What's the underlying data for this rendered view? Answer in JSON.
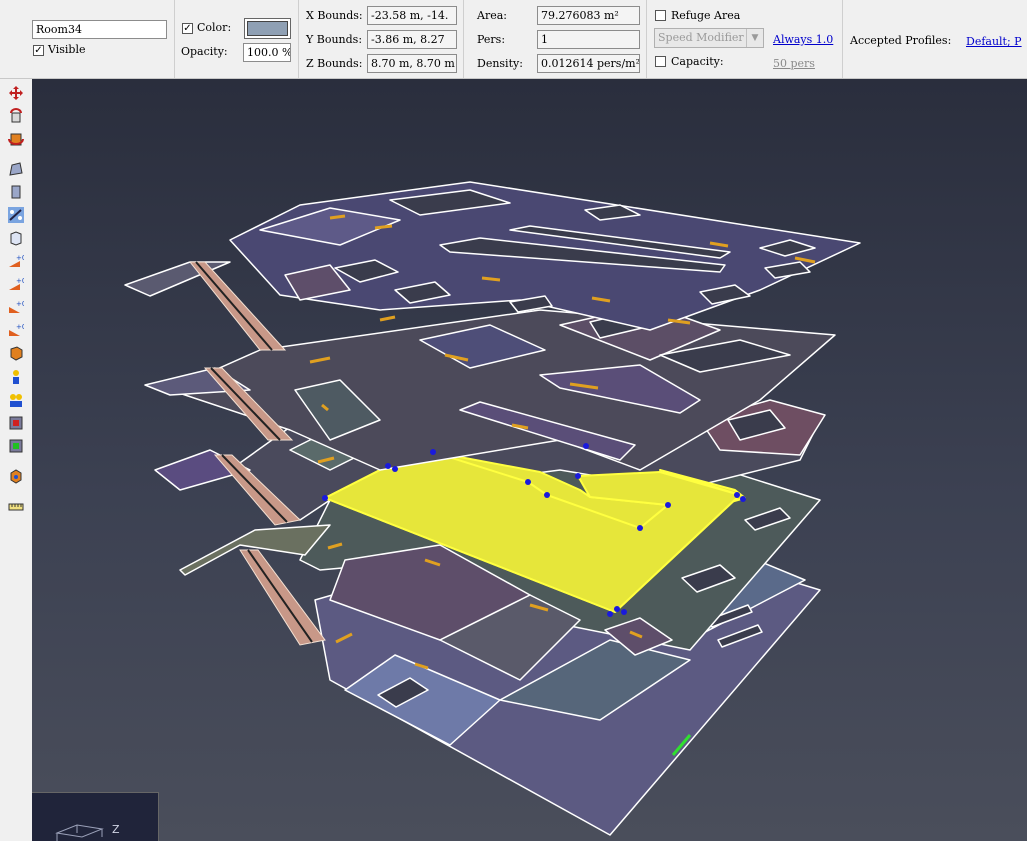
{
  "room": {
    "name": "Room34",
    "visible_label": "Visible",
    "visible_checked": true,
    "color_label": "Color:",
    "color_checked": true,
    "color_value": "#8fa0b4",
    "opacity_label": "Opacity:",
    "opacity_value": "100.0 %"
  },
  "bounds": {
    "x_label": "X Bounds:",
    "x_value": "-23.58 m, -14.",
    "y_label": "Y Bounds:",
    "y_value": "-3.86 m, 8.27",
    "z_label": "Z Bounds:",
    "z_value": "8.70 m, 8.70 m"
  },
  "stats": {
    "area_label": "Area:",
    "area_value": "79.276083 m²",
    "pers_label": "Pers:",
    "pers_value": "1",
    "density_label": "Density:",
    "density_value": "0.012614 pers/m²"
  },
  "refuge": {
    "refuge_label": "Refuge Area",
    "refuge_checked": false,
    "speed_modifier": "Speed Modifier",
    "speed_link": "Always 1.0",
    "capacity_label": "Capacity:",
    "capacity_checked": false,
    "capacity_link": "50 pers"
  },
  "profiles": {
    "label": "Accepted Profiles:",
    "link": "Default; P"
  },
  "toolbar_icons": [
    "move-icon",
    "rotate-icon",
    "orbit-icon",
    "room-icon",
    "door-icon",
    "stair-icon",
    "wall-icon",
    "floor-up-icon",
    "floor-add-icon",
    "floor-down-icon",
    "floor-remove-icon",
    "obstruction-icon",
    "occupant-icon",
    "group-icon",
    "exit-icon",
    "target-icon",
    "measure-icon",
    "ruler-icon"
  ],
  "colors": {
    "selection": "#e6e63a",
    "door": "#e0a020",
    "wall": "#ffffff",
    "vertex": "#1a1adc"
  },
  "viewport": {
    "axis_label": "Z"
  }
}
